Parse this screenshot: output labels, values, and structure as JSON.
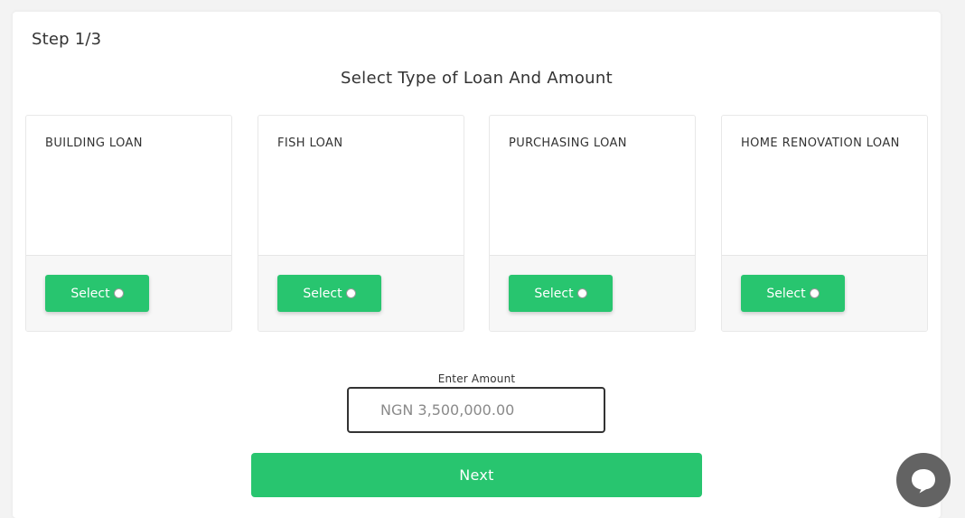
{
  "step": "Step 1/3",
  "heading": "Select Type of Loan And Amount",
  "loans": [
    {
      "title": "BUILDING LOAN",
      "button": "Select"
    },
    {
      "title": "FISH LOAN",
      "button": "Select"
    },
    {
      "title": "PURCHASING LOAN",
      "button": "Select"
    },
    {
      "title": "HOME RENOVATION LOAN",
      "button": "Select"
    }
  ],
  "amount": {
    "label": "Enter Amount",
    "value": "",
    "placeholder": "NGN 3,500,000.00"
  },
  "next_label": "Next",
  "colors": {
    "accent": "#28c56f",
    "chat": "#636363"
  },
  "icons": {
    "chat": "chat-bubble-icon",
    "radio": "radio-unchecked-icon"
  }
}
